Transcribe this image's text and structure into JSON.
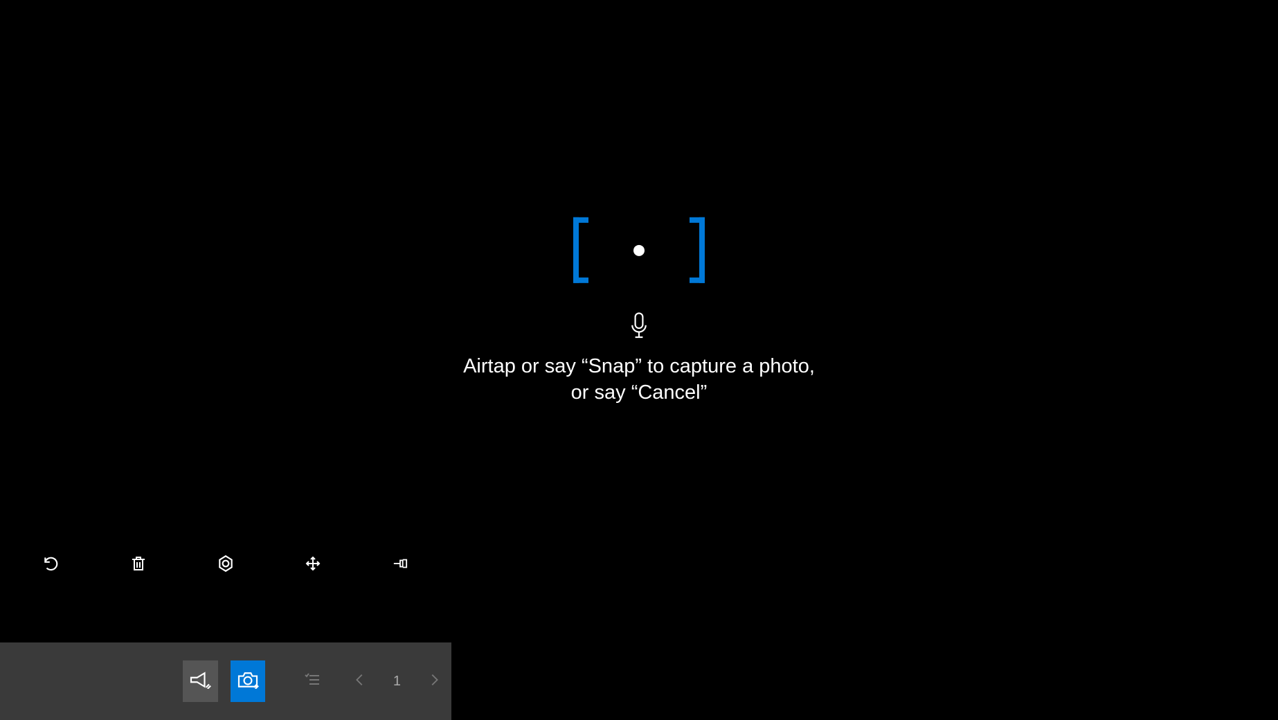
{
  "prompt": {
    "line1": "Airtap or say “Snap” to capture a photo,",
    "line2": "or say “Cancel”"
  },
  "reticle": {
    "color": "#0078d7"
  },
  "tools": {
    "undo": "undo",
    "delete": "delete",
    "target": "target",
    "move": "move",
    "pin": "pin"
  },
  "bottom_bar": {
    "announce": "announce",
    "camera": "camera",
    "list": "list",
    "prev": "previous",
    "page": "1",
    "next": "next"
  },
  "colors": {
    "accent": "#0078d7",
    "bar_bg": "#3a3a3a",
    "dim_btn": "#555555"
  }
}
